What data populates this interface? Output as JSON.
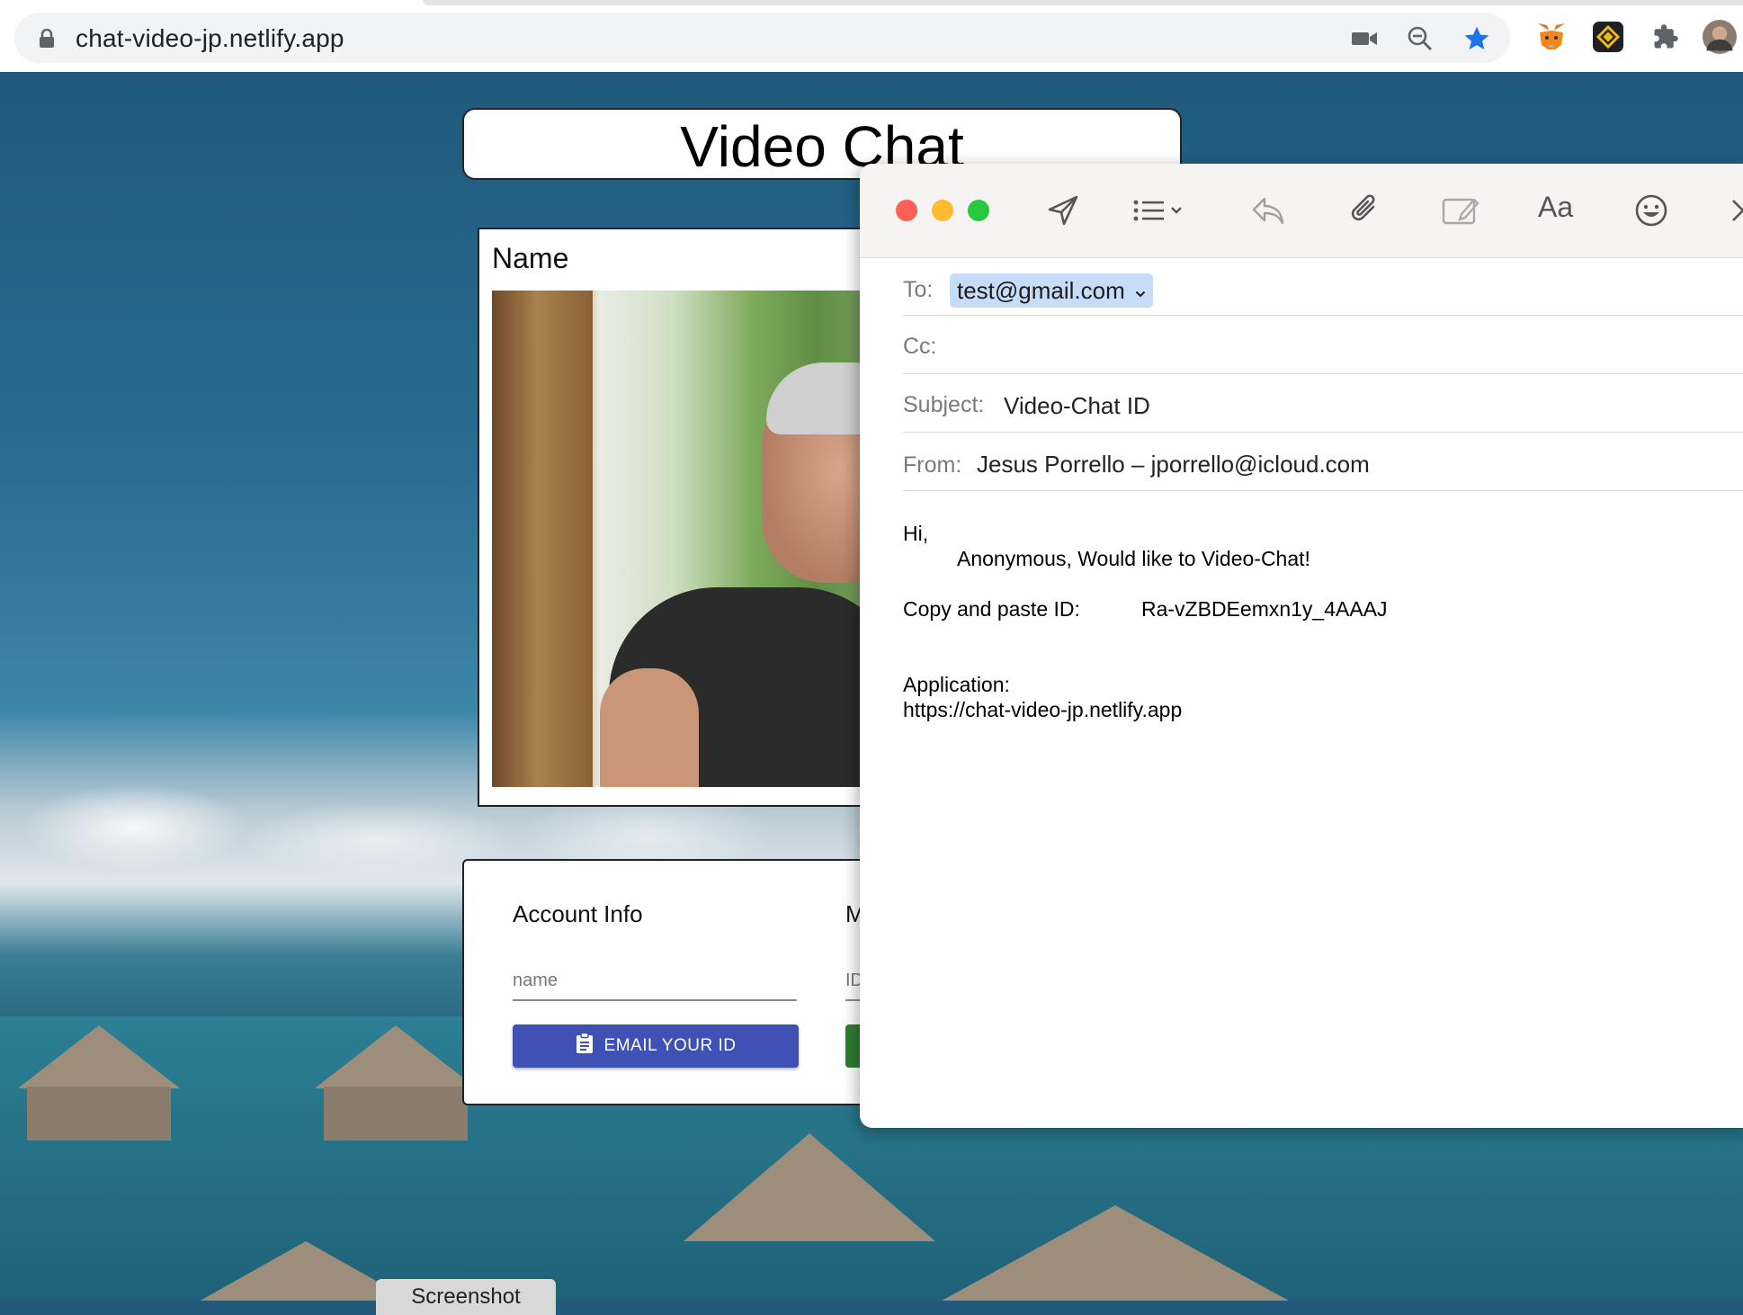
{
  "browser": {
    "url": "chat-video-jp.netlify.app",
    "icons": [
      "lock-icon",
      "camera-icon",
      "zoom-out-icon",
      "bookmark-star-icon",
      "metamask-extension-icon",
      "binance-extension-icon",
      "extensions-puzzle-icon",
      "profile-avatar"
    ],
    "star_color": "#1a73e8"
  },
  "app": {
    "title": "Video Chat",
    "video_label": "Name",
    "account": {
      "title": "Account Info",
      "second_title": "M",
      "name_placeholder": "name",
      "id_placeholder": "ID",
      "email_button": "EMAIL YOUR ID",
      "button_color": "#3f51b5",
      "second_button_color": "#2e7d32"
    },
    "screenshot_button": "Screenshot"
  },
  "mail": {
    "toolbar_icons": [
      "send-icon",
      "format-list-icon",
      "reply-icon",
      "attachment-icon",
      "markup-icon",
      "font-icon",
      "emoji-icon",
      "close-icon"
    ],
    "font_label": "Aa",
    "to_label": "To:",
    "to_value": "test@gmail.com",
    "cc_label": "Cc:",
    "subject_label": "Subject:",
    "subject_value": "Video-Chat ID",
    "from_label": "From:",
    "from_value": "Jesus Porrello – jporrello@icloud.com",
    "body": {
      "greeting": "Hi,",
      "line1": "Anonymous, Would like to Video-Chat!",
      "copy_label": "Copy and paste ID:",
      "copy_id": "Ra-vZBDEemxn1y_4AAAJ",
      "app_label": "Application:",
      "app_url": "https://chat-video-jp.netlify.app"
    },
    "traffic_lights": [
      "#ff5f57",
      "#febc2e",
      "#28c840"
    ]
  }
}
